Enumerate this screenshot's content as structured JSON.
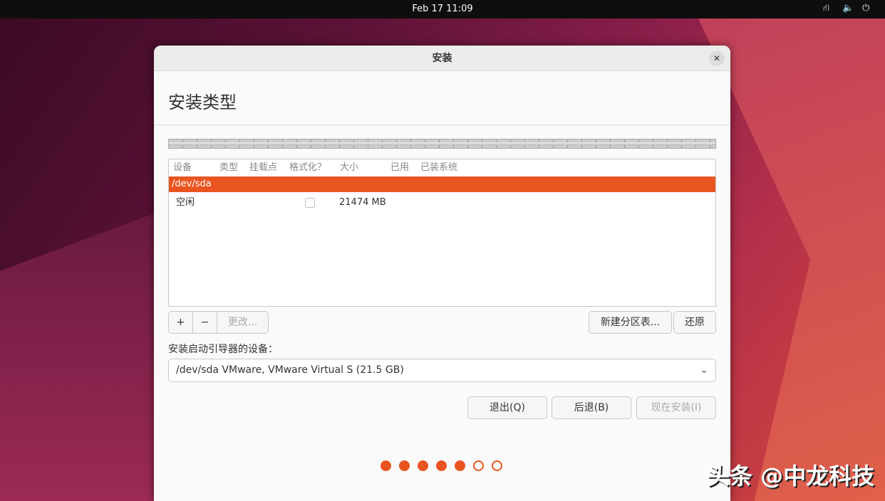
{
  "topbar": {
    "clock": "Feb 17  11:09",
    "icons": [
      "network-icon",
      "volume-icon",
      "power-icon"
    ]
  },
  "window": {
    "title": "安装",
    "close": "✕",
    "heading": "安装类型"
  },
  "table": {
    "headers": [
      "设备",
      "类型",
      "挂载点",
      "格式化？",
      "大小",
      "已用",
      "已装系统"
    ],
    "device": "/dev/sda",
    "rows": [
      {
        "device": "空闲",
        "format": false,
        "size": "21474 MB"
      }
    ]
  },
  "partition_buttons": {
    "add": "+",
    "remove": "−",
    "change": "更改...",
    "new_table": "新建分区表...",
    "revert": "还原"
  },
  "boot": {
    "label": "安装启动引导器的设备：",
    "value": "/dev/sda VMware, VMware Virtual S (21.5 GB)"
  },
  "actions": {
    "quit": "退出(Q)",
    "back": "后退(B)",
    "install": "现在安装(I)"
  },
  "progress": {
    "total_steps": 7,
    "completed_steps": 5
  },
  "watermark": "头条 @中龙科技",
  "colors": {
    "accent": "#e95420"
  }
}
